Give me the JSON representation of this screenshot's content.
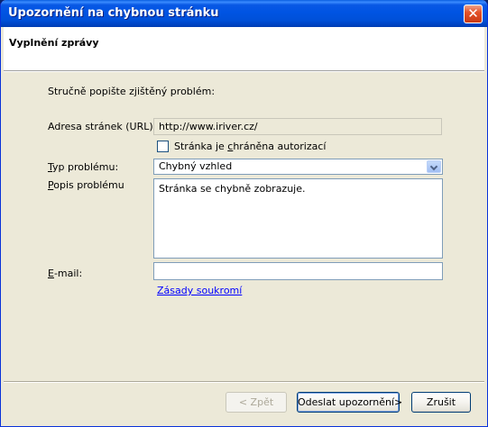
{
  "window": {
    "title": "Upozornění na chybnou stránku",
    "close_glyph": "✕"
  },
  "header": {
    "title": "Vyplnění zprávy"
  },
  "form": {
    "intro": "Stručně popište zjištěný problém:",
    "url": {
      "label": "Adresa stránek (URL):",
      "value": "http://www.iriver.cz/"
    },
    "auth_checkbox": {
      "label_prefix": "Stránka je ",
      "label_accel": "c",
      "label_suffix": "hráněna autorizací",
      "checked": false
    },
    "problem_type": {
      "label_accel": "T",
      "label_rest": "yp problému:",
      "value": "Chybný vzhled"
    },
    "description": {
      "label_accel": "P",
      "label_rest": "opis problému",
      "value": "Stránka se chybně zobrazuje."
    },
    "email": {
      "label_accel": "E",
      "label_rest": "-mail:",
      "value": ""
    },
    "privacy_link": "Zásady soukromí"
  },
  "buttons": {
    "back": "< Zpět",
    "send": "Odeslat upozornění>",
    "cancel": "Zrušit"
  },
  "icons": {
    "close": "close-icon",
    "dropdown": "chevron-down-icon"
  }
}
